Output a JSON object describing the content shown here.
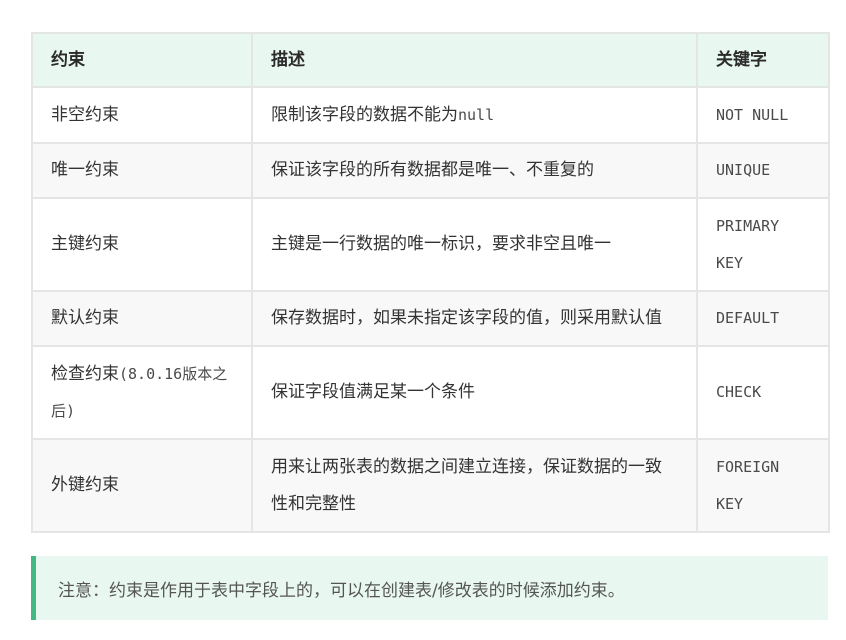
{
  "table": {
    "headers": [
      "约束",
      "描述",
      "关键字"
    ],
    "rows": [
      {
        "name": "非空约束",
        "name_suffix": "",
        "desc": "限制该字段的数据不能为",
        "desc_code": "null",
        "keyword": "NOT NULL"
      },
      {
        "name": "唯一约束",
        "name_suffix": "",
        "desc": "保证该字段的所有数据都是唯一、不重复的",
        "desc_code": "",
        "keyword": "UNIQUE"
      },
      {
        "name": "主键约束",
        "name_suffix": "",
        "desc": "主键是一行数据的唯一标识，要求非空且唯一",
        "desc_code": "",
        "keyword": "PRIMARY KEY"
      },
      {
        "name": "默认约束",
        "name_suffix": "",
        "desc": "保存数据时，如果未指定该字段的值，则采用默认值",
        "desc_code": "",
        "keyword": "DEFAULT"
      },
      {
        "name": "检查约束",
        "name_suffix": "(8.0.16版本之后)",
        "desc": "保证字段值满足某一个条件",
        "desc_code": "",
        "keyword": "CHECK"
      },
      {
        "name": "外键约束",
        "name_suffix": "",
        "desc": "用来让两张表的数据之间建立连接，保证数据的一致性和完整性",
        "desc_code": "",
        "keyword": "FOREIGN KEY"
      }
    ]
  },
  "note": {
    "text": "注意：约束是作用于表中字段上的，可以在创建表/修改表的时候添加约束。"
  },
  "colors": {
    "header_bg": "#e8f7f0",
    "note_bg": "#e8f7f0",
    "note_accent": "#42b983",
    "border": "#e3e6e5",
    "stripe": "#f8f8f8"
  }
}
